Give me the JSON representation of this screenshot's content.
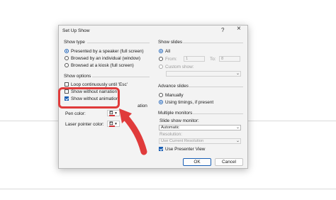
{
  "dialog": {
    "title": "Set Up Show",
    "help_label": "?",
    "close_label": "×"
  },
  "show_type": {
    "heading": "Show type",
    "options": [
      {
        "label": "Presented by a speaker (full screen)",
        "selected": true
      },
      {
        "label": "Browsed by an individual (window)",
        "selected": false
      },
      {
        "label": "Browsed at a kiosk (full screen)",
        "selected": false
      }
    ]
  },
  "show_options": {
    "heading": "Show options",
    "loop_label": "Loop continuously until 'Esc'",
    "without_narration_label": "Show without narration",
    "without_animation_label": "Show without animation",
    "hidden_option_suffix": "ation",
    "pen_color_label": "Pen color:",
    "laser_color_label": "Laser pointer color:"
  },
  "show_slides": {
    "heading": "Show slides",
    "all_label": "All",
    "from_label": "From:",
    "from_value": "1",
    "to_label": "To:",
    "to_value": "8",
    "custom_show_label": "Custom show:"
  },
  "advance_slides": {
    "heading": "Advance slides",
    "manually_label": "Manually",
    "timings_label": "Using timings, if present"
  },
  "multiple_monitors": {
    "heading": "Multiple monitors",
    "monitor_label": "Slide show monitor:",
    "monitor_value": "Automatic",
    "resolution_label": "Resolution:",
    "resolution_value": "Use Current Resolution",
    "presenter_view_label": "Use Presenter View"
  },
  "buttons": {
    "ok": "OK",
    "cancel": "Cancel"
  },
  "colors": {
    "accent": "#1a5fb4",
    "annotation": "#e03b3b"
  }
}
